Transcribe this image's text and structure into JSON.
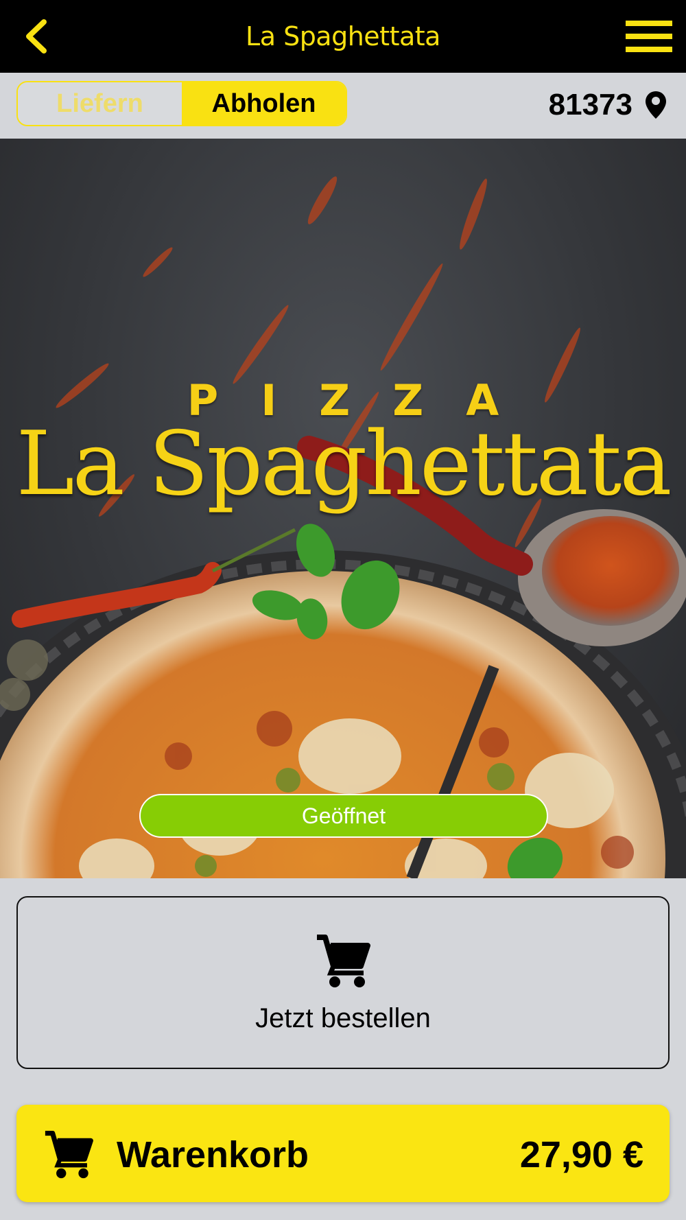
{
  "header": {
    "title": "La Spaghettata",
    "back_icon": "chevron-left-icon",
    "menu_icon": "hamburger-menu-icon",
    "accent_color": "#f9e112"
  },
  "mode_toggle": {
    "options": [
      "Liefern",
      "Abholen"
    ],
    "selected": "Abholen"
  },
  "location": {
    "zip": "81373",
    "icon": "map-pin-icon"
  },
  "hero": {
    "logo_top": "PIZZA",
    "logo_name": "La Spaghettata",
    "status": "Geöffnet",
    "status_color": "#87cd05"
  },
  "order_button": {
    "label": "Jetzt bestellen",
    "icon": "cart-icon"
  },
  "cart_bar": {
    "label": "Warenkorb",
    "total": "27,90 €",
    "icon": "cart-icon"
  }
}
